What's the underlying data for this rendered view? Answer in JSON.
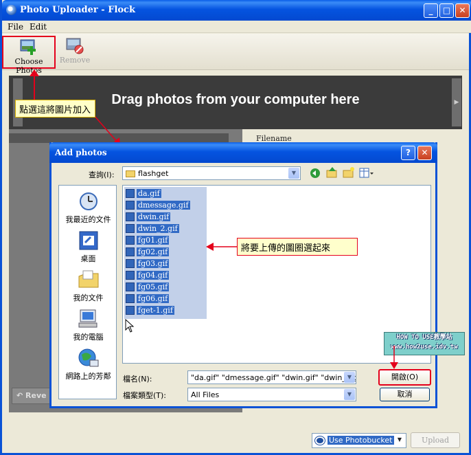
{
  "window": {
    "title": "Photo Uploader - Flock"
  },
  "menu": [
    "File",
    "Edit"
  ],
  "toolbar": {
    "choose_label": "Choose Photos",
    "remove_label": "Remove"
  },
  "dropzone": {
    "text": "Drag photos from your computer here"
  },
  "header": {
    "filename": "Filename"
  },
  "annotations": {
    "tip1": "點選這將圖片加入",
    "tip2": "將要上傳的圖圈選起來"
  },
  "revert_label": "Reve",
  "dialog": {
    "title": "Add photos",
    "lookin_label": "查詢(I):",
    "lookin_value": "flashget",
    "places": [
      "我最近的文件",
      "桌面",
      "我的文件",
      "我的電腦",
      "網路上的芳鄰"
    ],
    "files": [
      "da.gif",
      "dmessage.gif",
      "dwin.gif",
      "dwin_2.gif",
      "fg01.gif",
      "fg02.gif",
      "fg03.gif",
      "fg04.gif",
      "fg05.gif",
      "fg06.gif",
      "fget-1.gif"
    ],
    "filename_label": "檔名(N):",
    "filename_value": "\"da.gif\" \"dmessage.gif\" \"dwin.gif\" \"dwin_2.gif\"",
    "filetype_label": "檔案類型(T):",
    "filetype_value": "All Files",
    "open_label": "開啟(O)",
    "cancel_label": "取消"
  },
  "watermark": {
    "line1": "HOW TO USE教學站",
    "line2": "www.how2use.idv.tw"
  },
  "bottom": {
    "service": "Use Photobucket",
    "upload_label": "Upload"
  },
  "colors": {
    "accent": "#0a52d6",
    "highlight": "#e4001b"
  }
}
